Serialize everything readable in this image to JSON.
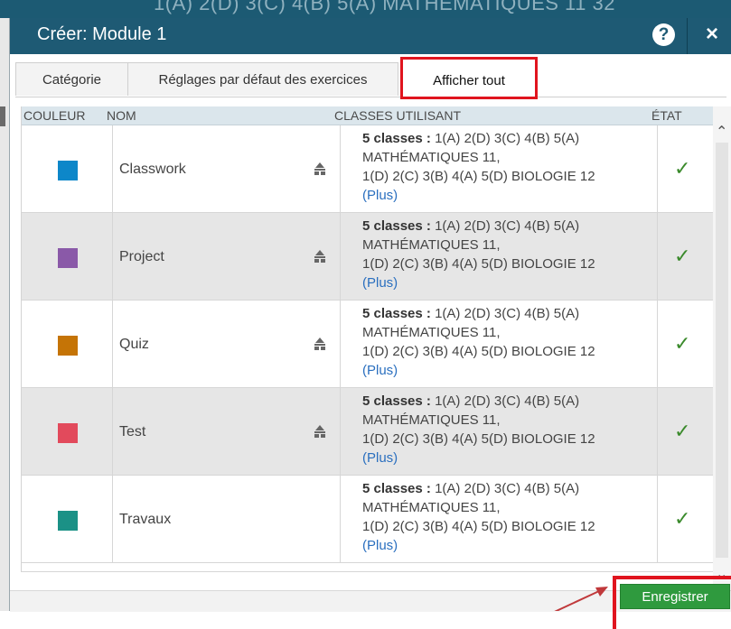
{
  "background_header_text": "1(A) 2(D) 3(C) 4(B) 5(A) MATHÉMATIQUES 11 32",
  "dialog": {
    "title": "Créer: Module 1",
    "help_label": "?",
    "close_label": "×"
  },
  "tabs": [
    {
      "label": "Catégorie"
    },
    {
      "label": "Réglages par défaut des exercices"
    },
    {
      "label": "Afficher tout"
    }
  ],
  "table": {
    "headers": {
      "couleur": "COULEUR",
      "nom": "NOM",
      "classes": "CLASSES UTILISANT",
      "etat": "ÉTAT"
    },
    "rows": [
      {
        "color": "#0d87c9",
        "name": "Classwork",
        "classes_count": "5 classes :",
        "line1": " 1(A) 2(D) 3(C) 4(B) 5(A)",
        "line2": "MATHÉMATIQUES 11,",
        "line3": "1(D) 2(C) 3(B) 4(A) 5(D) BIOLOGIE 12",
        "more": "(Plus)",
        "status": "✓"
      },
      {
        "color": "#8a59a8",
        "name": "Project",
        "classes_count": "5 classes :",
        "line1": " 1(A) 2(D) 3(C) 4(B) 5(A)",
        "line2": "MATHÉMATIQUES 11,",
        "line3": "1(D) 2(C) 3(B) 4(A) 5(D) BIOLOGIE 12",
        "more": "(Plus)",
        "status": "✓"
      },
      {
        "color": "#c57406",
        "name": "Quiz",
        "classes_count": "5 classes :",
        "line1": " 1(A) 2(D) 3(C) 4(B) 5(A)",
        "line2": "MATHÉMATIQUES 11,",
        "line3": "1(D) 2(C) 3(B) 4(A) 5(D) BIOLOGIE 12",
        "more": "(Plus)",
        "status": "✓"
      },
      {
        "color": "#e24a5c",
        "name": "Test",
        "classes_count": "5 classes :",
        "line1": " 1(A) 2(D) 3(C) 4(B) 5(A)",
        "line2": "MATHÉMATIQUES 11,",
        "line3": "1(D) 2(C) 3(B) 4(A) 5(D) BIOLOGIE 12",
        "more": "(Plus)",
        "status": "✓"
      },
      {
        "color": "#1b9186",
        "name": "Travaux",
        "classes_count": "5 classes :",
        "line1": " 1(A) 2(D) 3(C) 4(B) 5(A)",
        "line2": "MATHÉMATIQUES 11,",
        "line3": "1(D) 2(C) 3(B) 4(A) 5(D) BIOLOGIE 12",
        "more": "(Plus)",
        "status": "✓"
      }
    ]
  },
  "footer": {
    "save_label": "Enregistrer"
  },
  "colors": {
    "titlebar": "#1e5a74",
    "highlight": "#e0141e",
    "save_button": "#2f9a3e",
    "check": "#3a8a2b",
    "link": "#2a6fbf"
  }
}
